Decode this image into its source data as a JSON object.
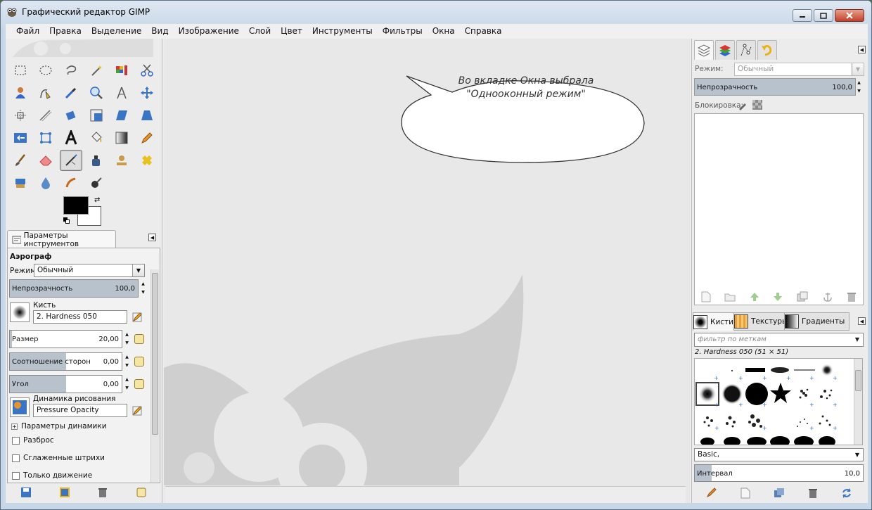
{
  "window": {
    "title": "Графический редактор GIMP"
  },
  "menubar": [
    {
      "label": "Файл"
    },
    {
      "label": "Правка"
    },
    {
      "label": "Выделение"
    },
    {
      "label": "Вид"
    },
    {
      "label": "Изображение"
    },
    {
      "label": "Слой"
    },
    {
      "label": "Цвет"
    },
    {
      "label": "Инструменты"
    },
    {
      "label": "Фильтры"
    },
    {
      "label": "Окна"
    },
    {
      "label": "Справка"
    }
  ],
  "tool_options": {
    "tab_label": "Параметры инструментов",
    "tool_name": "Аэрограф",
    "mode_label": "Режим:",
    "mode_value": "Обычный",
    "opacity": {
      "label": "Непрозрачность",
      "value": "100,0",
      "level": 1.0
    },
    "brush_label": "Кисть",
    "brush_value": "2. Hardness 050",
    "size": {
      "label": "Размер",
      "value": "20,00",
      "level": 0.02
    },
    "aspect": {
      "label": "Соотношение сторон",
      "value": "0,00",
      "level": 0.5
    },
    "angle": {
      "label": "Угол",
      "value": "0,00",
      "level": 0.5
    },
    "dynamics_label": "Динамика рисования",
    "dynamics_value": "Pressure Opacity",
    "dynamics_params": "Параметры динамики",
    "checkboxes": [
      {
        "label": "Разброс",
        "checked": false
      },
      {
        "label": "Сглаженные штрихи",
        "checked": false
      },
      {
        "label": "Только движение",
        "checked": false
      }
    ]
  },
  "callout": {
    "line1": "Во вкладке Окна выбрала",
    "line2": "\"Однооконный режим\""
  },
  "layers": {
    "mode_label": "Режим:",
    "mode_value": "Обычный",
    "opacity_label": "Непрозрачность",
    "opacity_value": "100,0",
    "lock_label": "Блокировка:"
  },
  "brushes_dock": {
    "tabs": [
      {
        "label": "Кисти",
        "icon": "brush-preview-icon"
      },
      {
        "label": "Текстуры",
        "icon": "pattern-swatch-icon"
      },
      {
        "label": "Градиенты",
        "icon": "gradient-swatch-icon"
      }
    ],
    "filter_placeholder": "фильтр по меткам",
    "selected_brush": "2. Hardness 050 (51 × 51)",
    "tag_value": "Basic,",
    "spacing_label": "Интервал",
    "spacing_value": "10,0",
    "spacing_level": 0.1
  },
  "colors": {
    "foreground": "#000000",
    "background": "#ffffff",
    "accent": "#b7c2cc"
  }
}
